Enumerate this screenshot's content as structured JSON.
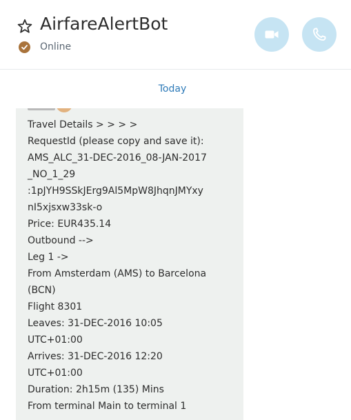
{
  "header": {
    "title": "AirfareAlertBot",
    "status": "Online"
  },
  "conversation": {
    "day_label": "Today",
    "message_lines": [
      "Travel Details > > > >",
      "RequestId (please copy and save it):",
      "AMS_ALC_31-DEC-2016_08-JAN-2017",
      "_NO_1_29",
      ":1pJYH9SSkJErg9Al5MpW8JhqnJMYxy",
      "nI5xjsxw33sk-o",
      "Price: EUR435.14",
      "Outbound -->",
      "Leg 1 ->",
      "From Amsterdam (AMS) to Barcelona",
      "(BCN)",
      "Flight 8301",
      "Leaves: 31-DEC-2016 10:05",
      "UTC+01:00",
      "Arrives: 31-DEC-2016 12:20",
      "UTC+01:00",
      "Duration: 2h15m (135) Mins",
      "From terminal Main to terminal 1"
    ]
  },
  "icons": {
    "favorite": "star-outline-icon",
    "status": "check-circle-icon",
    "video_call": "video-camera-icon",
    "audio_call": "phone-icon"
  },
  "colors": {
    "call_button_bg": "#c6e4f3",
    "status_dot": "#a9733b",
    "day_label": "#2d7ab8",
    "bubble_bg": "#eef1ef"
  }
}
